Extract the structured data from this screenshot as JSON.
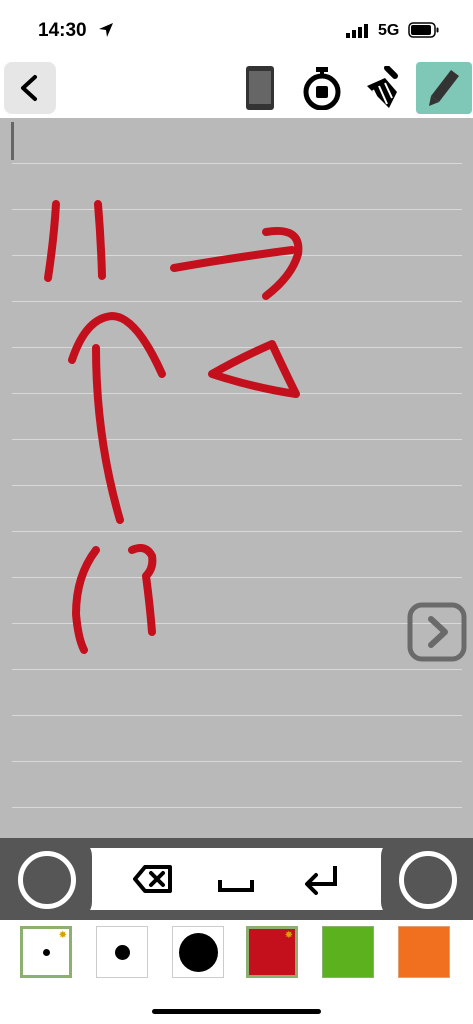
{
  "status_bar": {
    "time": "14:30",
    "network": "5G"
  },
  "toolbar": {
    "back_icon": "chevron-left-icon",
    "tools": [
      "phone-icon",
      "stopwatch-icon",
      "broom-icon",
      "pencil-icon"
    ],
    "active_tool": "pencil-icon",
    "active_color": "#7fc7b7"
  },
  "canvas": {
    "background": "#b9b9b9",
    "ink_color": "#c4101c",
    "next_icon": "chevron-right-icon"
  },
  "keyboard": {
    "keys": [
      "backspace-icon",
      "space-icon",
      "return-icon"
    ]
  },
  "palette": {
    "swatches": [
      {
        "kind": "pen-size-small",
        "color": "#000000",
        "selected": true
      },
      {
        "kind": "pen-size-medium",
        "color": "#000000",
        "selected": false
      },
      {
        "kind": "pen-size-large",
        "color": "#000000",
        "selected": false
      },
      {
        "kind": "color",
        "color": "#c4101c",
        "selected": true
      },
      {
        "kind": "color",
        "color": "#5cb21e",
        "selected": false
      },
      {
        "kind": "color",
        "color": "#f07020",
        "selected": false
      }
    ]
  }
}
